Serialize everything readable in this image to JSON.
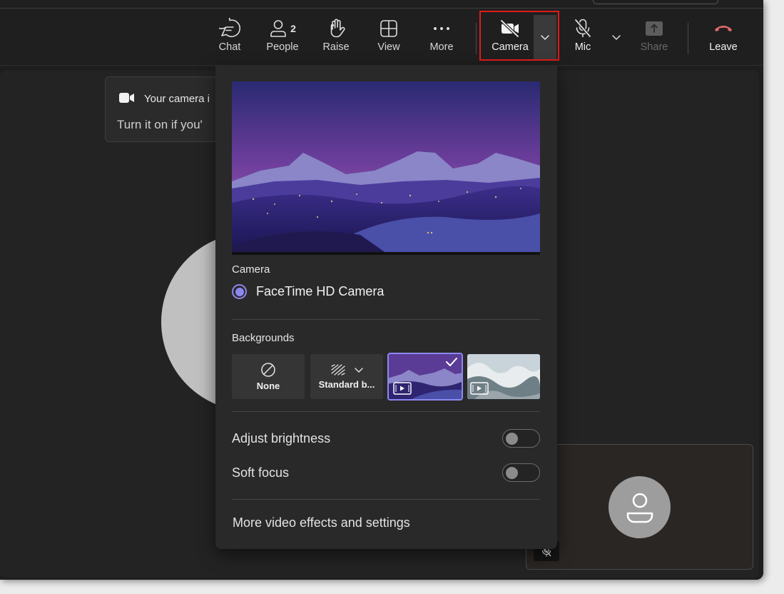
{
  "toolbar": {
    "chat_label": "Chat",
    "people_label": "People",
    "people_count": "2",
    "raise_label": "Raise",
    "view_label": "View",
    "more_label": "More",
    "camera_label": "Camera",
    "mic_label": "Mic",
    "share_label": "Share",
    "leave_label": "Leave"
  },
  "notice": {
    "title": "Your camera i",
    "body": "Turn it on if you'"
  },
  "camera_menu": {
    "camera_section": "Camera",
    "selected_camera": "FaceTime HD Camera",
    "backgrounds_section": "Backgrounds",
    "backgrounds": [
      {
        "label": "None"
      },
      {
        "label": "Standard b..."
      }
    ],
    "adjust_brightness": {
      "label": "Adjust brightness",
      "on": false
    },
    "soft_focus": {
      "label": "Soft focus",
      "on": false
    },
    "more_link": "More video effects and settings"
  },
  "colors": {
    "accent": "#8c88f0",
    "leave_red": "#e46a6a",
    "highlight_red": "#e01b1b"
  },
  "icons": [
    "chat-icon",
    "people-icon",
    "hand-raise-icon",
    "view-grid-icon",
    "more-icon",
    "camera-off-icon",
    "chevron-down-icon",
    "mic-off-icon",
    "share-icon",
    "leave-phone-icon",
    "none-icon",
    "blur-icon",
    "checkmark-icon",
    "video-background-icon",
    "person-icon"
  ]
}
